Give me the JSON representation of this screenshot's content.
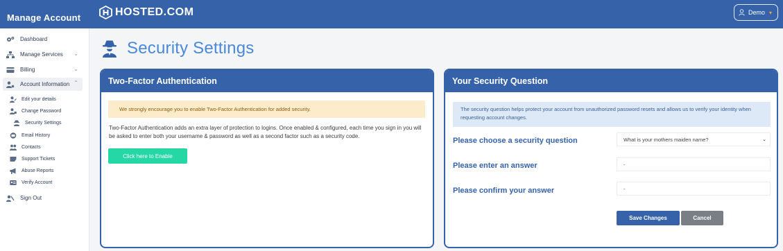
{
  "header": {
    "section_title": "Manage Account",
    "logo_text": "HOSTED.COM",
    "user_label": "Demo"
  },
  "sidebar": {
    "items": [
      {
        "label": "Dashboard",
        "icon": "gears-icon"
      },
      {
        "label": "Manage Services",
        "icon": "sitemap-icon"
      },
      {
        "label": "Billing",
        "icon": "credit-card-icon"
      },
      {
        "label": "Account Information",
        "icon": "user-gear-icon"
      }
    ],
    "sub_items": [
      {
        "label": "Edit your details",
        "icon": "user-edit-icon"
      },
      {
        "label": "Change Password",
        "icon": "user-lock-icon"
      },
      {
        "label": "Security Settings",
        "icon": "user-secret-icon"
      },
      {
        "label": "Email History",
        "icon": "envelope-icon"
      },
      {
        "label": "Contacts",
        "icon": "users-icon"
      },
      {
        "label": "Support Tickets",
        "icon": "ticket-icon"
      },
      {
        "label": "Abuse Reports",
        "icon": "megaphone-icon"
      },
      {
        "label": "Verify Account",
        "icon": "id-card-icon"
      }
    ],
    "sign_out": "Sign Out"
  },
  "page": {
    "title": "Security Settings"
  },
  "tfa": {
    "heading": "Two-Factor Authentication",
    "warning": "We strongly encourage you to enable Two-Factor Authentication for added security.",
    "description": "Two-Factor Authentication adds an extra layer of protection to logins. Once enabled & configured, each time you sign in you will be asked to enter both your username & password as well as a second factor such as a security code.",
    "enable_button": "Click here to Enable"
  },
  "security_question": {
    "heading": "Your Security Question",
    "info": "The security question helps protect your account from unauthorized password resets and allows us to verify your identity when requesting account changes.",
    "choose_label": "Please choose a security question",
    "selected_question": "What is your mothers maiden name?",
    "answer_label": "Please enter an answer",
    "answer_value": "-",
    "confirm_label": "Please confirm your answer",
    "confirm_value": "-",
    "save_button": "Save Changes",
    "cancel_button": "Cancel"
  },
  "colors": {
    "brand": "#3562a8",
    "accent": "#26d7a6",
    "title": "#4a88d8",
    "warning_bg": "#fcecc9",
    "info_bg": "#dde9f7"
  }
}
